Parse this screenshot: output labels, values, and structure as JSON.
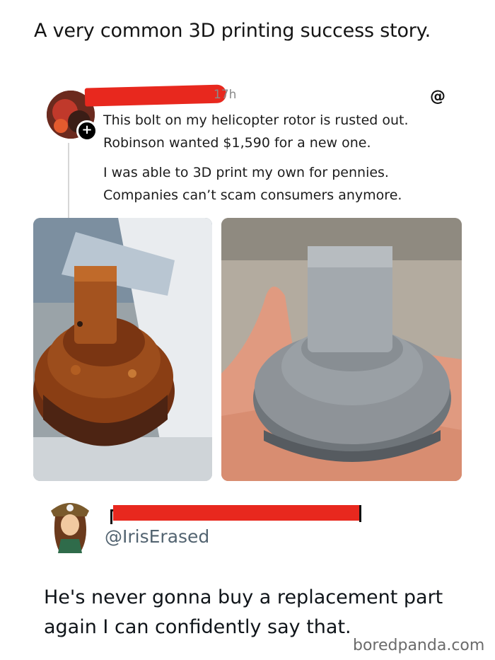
{
  "meme": {
    "title": "A very common 3D printing success story."
  },
  "post": {
    "time": "17h",
    "plus_glyph": "+",
    "threads_glyph": "@",
    "line1": "This bolt on my helicopter rotor is rusted out.",
    "line2": "Robinson wanted $1,590 for a new one.",
    "line3": "I was able to 3D print my own for pennies.",
    "line4": "Companies can’t scam consumers anymore.",
    "images": [
      "rusted-bolt-photo",
      "3d-printed-bolt-photo"
    ]
  },
  "reply": {
    "handle": "@IrisErased",
    "line1": "He's never gonna buy a replacement part",
    "line2": "again I can confidently say that."
  },
  "watermark": "boredpanda.com",
  "colors": {
    "redaction": "#e8281e",
    "handle": "#536471",
    "rust": "#8a3e14",
    "print_gray": "#8e9398"
  }
}
